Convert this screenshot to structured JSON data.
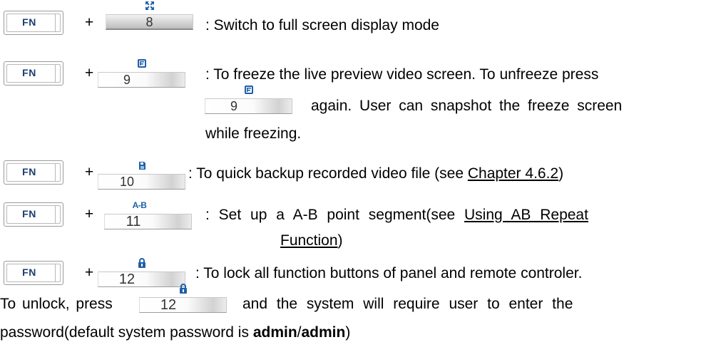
{
  "keys": {
    "fn_label": "FN",
    "plus": "+",
    "num_8": "8",
    "num_9": "9",
    "num_10": "10",
    "num_11": "11",
    "num_12": "12",
    "ab_icon_text": "A-B"
  },
  "icons": {
    "fullscreen": "fullscreen-icon",
    "freeze": "freeze-icon",
    "backup": "backup-icon",
    "ab_repeat": "ab-repeat-icon",
    "lock": "lock-icon"
  },
  "colors": {
    "icon_blue": "#1f5fa8",
    "fn_text": "#1a3d6e"
  },
  "rows": {
    "r1": ": Switch to full screen display mode",
    "r2_line1": ": To freeze the live preview video screen. To unfreeze press",
    "r2_line2": "again. User can snapshot the freeze screen",
    "r2_line3": "while freezing.",
    "r3_pre": ": To quick backup recorded video file (see ",
    "r3_link": "Chapter 4.6.2",
    "r3_post": ")",
    "r4_pre": ": Set up a A-B point segment(see ",
    "r4_link1": "Using AB Repeat",
    "r4_link2": "Function",
    "r4_post": ")",
    "r5_line1": ": To lock all function buttons of panel and remote controler.",
    "r5_line2_pre": "To unlock, press",
    "r5_line2_post": "and the system will require user to enter the",
    "r5_line3_pre": "password(default system password is ",
    "r5_bold1": "admin",
    "r5_slash": "/",
    "r5_bold2": "admin",
    "r5_line3_post": ")"
  }
}
